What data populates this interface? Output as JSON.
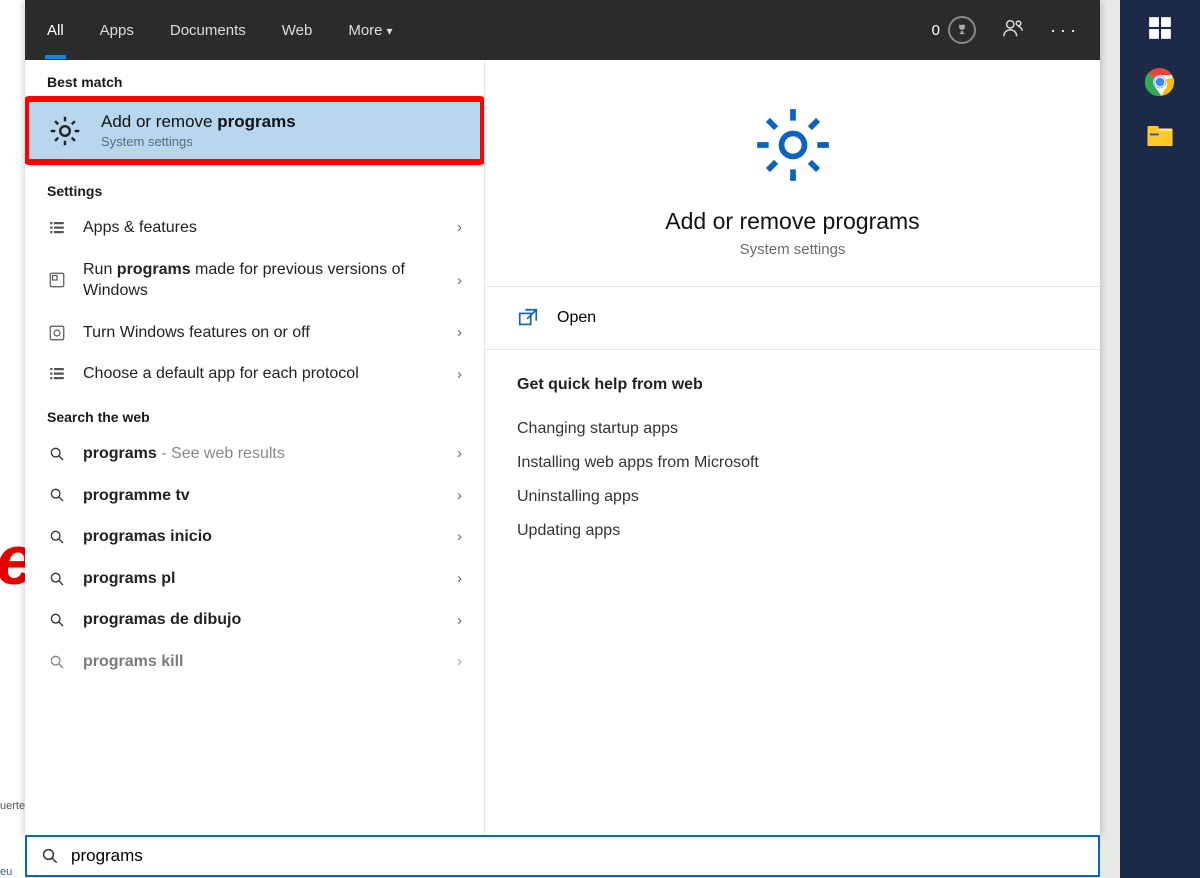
{
  "tabs": {
    "all": "All",
    "apps": "Apps",
    "documents": "Documents",
    "web": "Web",
    "more": "More"
  },
  "reward_count": "0",
  "sections": {
    "best_match": "Best match",
    "settings": "Settings",
    "search_web": "Search the web"
  },
  "best_match": {
    "title_plain": "Add or remove ",
    "title_bold": "programs",
    "subtitle": "System settings"
  },
  "settings_results": [
    {
      "text": "Apps & features",
      "bold": "",
      "hint": ""
    },
    {
      "text": "Run ",
      "bold": "programs",
      "text2": " made for previous versions of Windows"
    },
    {
      "text": "Turn Windows features on or off",
      "bold": "",
      "text2": ""
    },
    {
      "text": "Choose a default app for each protocol",
      "bold": "",
      "text2": ""
    }
  ],
  "web_results": [
    {
      "bold": "programs",
      "hint": " - See web results"
    },
    {
      "bold": "programme tv",
      "hint": ""
    },
    {
      "bold": "programas inicio",
      "hint": ""
    },
    {
      "bold": "programs pl",
      "hint": ""
    },
    {
      "bold": "programas de dibujo",
      "hint": ""
    },
    {
      "bold": "programs kill",
      "hint": ""
    }
  ],
  "detail": {
    "title": "Add or remove programs",
    "subtitle": "System settings",
    "open_label": "Open",
    "quick_help_header": "Get quick help from web",
    "quick_links": [
      "Changing startup apps",
      "Installing web apps from Microsoft",
      "Uninstalling apps",
      "Updating apps"
    ]
  },
  "search_input": {
    "value": "programs"
  },
  "bg": {
    "snippet": "uerte",
    "snippet2": "eu"
  }
}
